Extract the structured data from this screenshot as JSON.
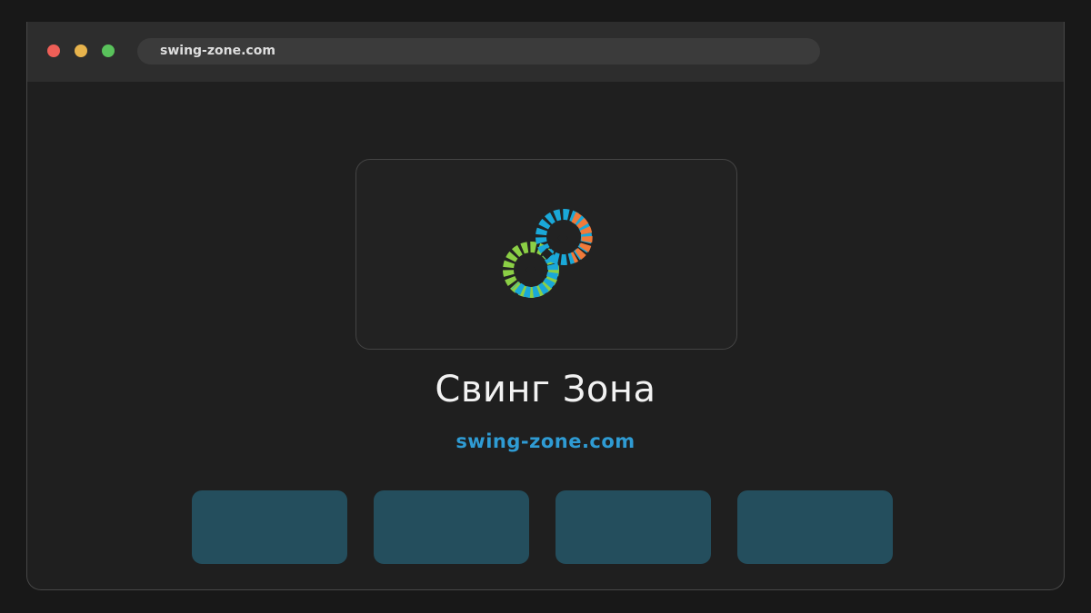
{
  "browser": {
    "address": "swing-zone.com"
  },
  "site": {
    "title": "Свинг Зона",
    "url": "swing-zone.com",
    "logo_icon": "linked-rings-logo-icon"
  },
  "tiles": [
    {
      "label": ""
    },
    {
      "label": ""
    },
    {
      "label": ""
    },
    {
      "label": ""
    }
  ],
  "colors": {
    "background": "#181818",
    "window": "#1f1f1f",
    "titlebar": "#2d2d2d",
    "address_bar": "#3b3b3b",
    "accent_url": "#2f9bd3",
    "tile": "#244e5d",
    "close_dot": "#ee5f57",
    "minimize_dot": "#e7b34c",
    "maximize_dot": "#59c25b",
    "logo_green": "#8bcf45",
    "logo_blue": "#1aa8d8",
    "logo_orange": "#f07a3a"
  }
}
